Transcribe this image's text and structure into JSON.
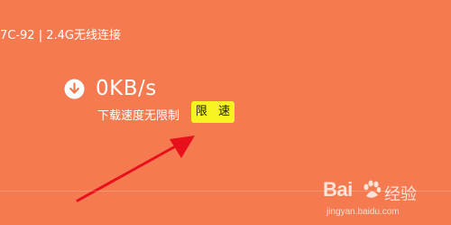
{
  "device": {
    "connection_text": "7C-92 | 2.4G无线连接"
  },
  "download": {
    "icon": "download-arrow-icon",
    "speed": "0KB/s",
    "limit_status": "下载速度无限制",
    "limit_button_label": "限 速"
  },
  "watermark": {
    "logo": "Bai",
    "logo_suffix": "经验",
    "url": "jingyan.baidu.com"
  },
  "colors": {
    "background": "#f57a50",
    "button": "#f7f320",
    "arrow": "#e8101a"
  }
}
